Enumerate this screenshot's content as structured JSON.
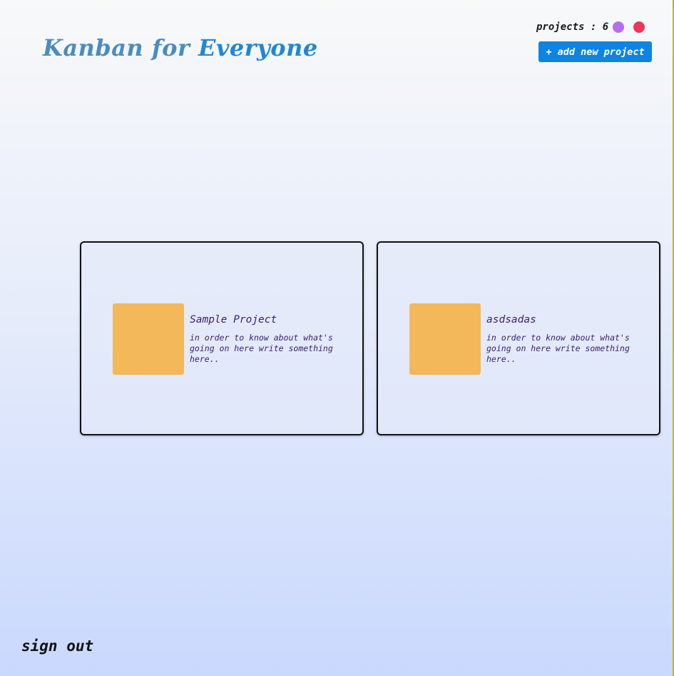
{
  "header": {
    "title_part1": "Kanban for",
    "title_part2": "Everyone",
    "projects_counter": "projects : 6",
    "status_dots": [
      "#b76cf2",
      "#f0355a"
    ],
    "add_button_label": "+ add new project"
  },
  "projects": [
    {
      "title": "Sample Project",
      "description": "in order to know about what's going on here write something here..",
      "thumb_color": "#f2b85a"
    },
    {
      "title": "asdsadas",
      "description": "in order to know about what's going on here write something here..",
      "thumb_color": "#f2b85a"
    }
  ],
  "footer": {
    "sign_out_label": "sign out"
  },
  "colors": {
    "accent": "#0d84e3",
    "title_primary": "#4a8cc0",
    "title_secondary": "#1f87d8",
    "card_text": "#3a1f6e"
  }
}
